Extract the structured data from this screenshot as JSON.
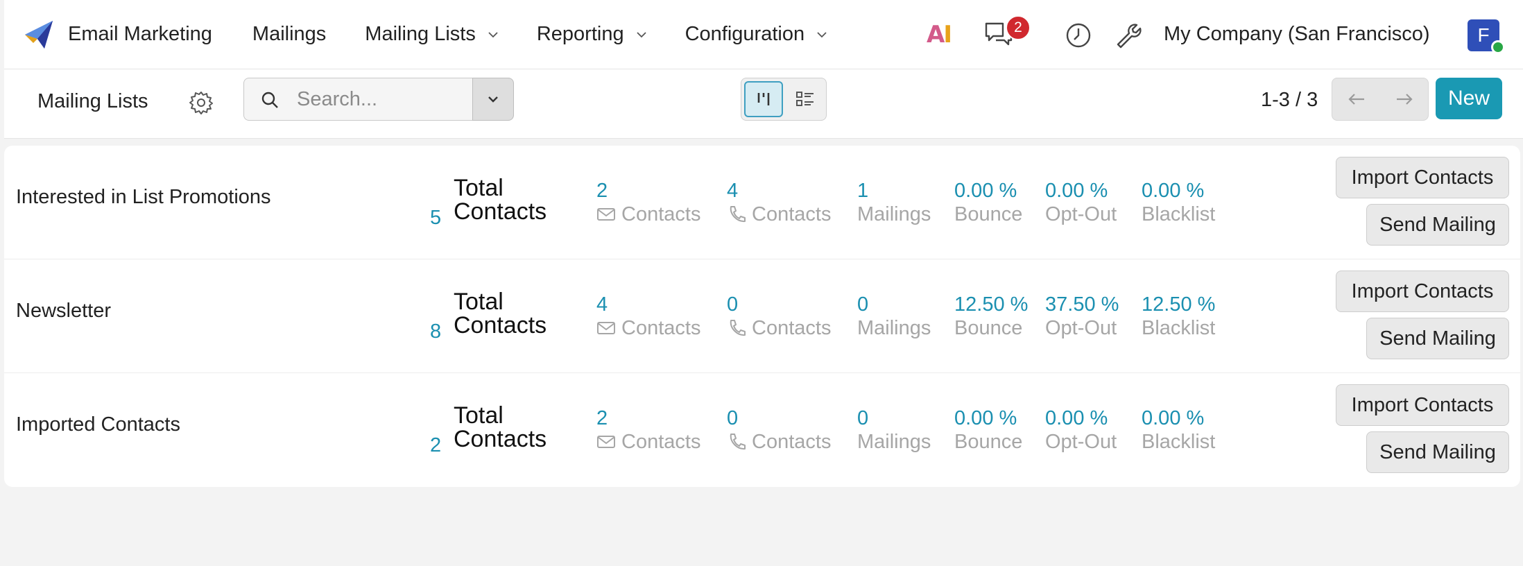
{
  "topnav": {
    "app_name": "Email Marketing",
    "menu": [
      "Mailings",
      "Mailing Lists",
      "Reporting",
      "Configuration"
    ],
    "ai_label_a": "A",
    "ai_label_i": "I",
    "chat_badge": "2",
    "company": "My Company (San Francisco)",
    "avatar_initial": "F"
  },
  "control": {
    "breadcrumb": "Mailing Lists",
    "search_placeholder": "Search...",
    "pager": "1-3 / 3",
    "new_label": "New"
  },
  "labels": {
    "total_line1": "Total",
    "total_line2": "Contacts",
    "email_contacts": "Contacts",
    "phone_contacts": "Contacts",
    "mailings": "Mailings",
    "bounce": "Bounce",
    "optout": "Opt-Out",
    "blacklist": "Blacklist",
    "import": "Import Contacts",
    "send": "Send Mailing"
  },
  "rows": [
    {
      "name": "Interested in List Promotions",
      "total": "5",
      "email": "2",
      "phone": "4",
      "mailings": "1",
      "bounce": "0.00 %",
      "optout": "0.00 %",
      "blacklist": "0.00 %"
    },
    {
      "name": "Newsletter",
      "total": "8",
      "email": "4",
      "phone": "0",
      "mailings": "0",
      "bounce": "12.50 %",
      "optout": "37.50 %",
      "blacklist": "12.50 %"
    },
    {
      "name": "Imported Contacts",
      "total": "2",
      "email": "2",
      "phone": "0",
      "mailings": "0",
      "bounce": "0.00 %",
      "optout": "0.00 %",
      "blacklist": "0.00 %"
    }
  ],
  "colors": {
    "accent": "#1a99b3",
    "badge": "#d0282e",
    "value": "#1a8fb0",
    "muted": "#a6a6a6"
  }
}
